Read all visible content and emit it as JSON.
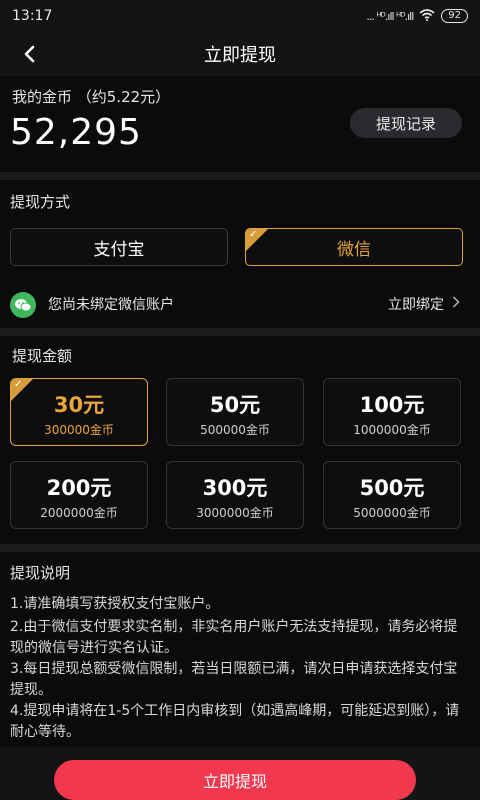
{
  "status": {
    "time": "13:17",
    "network": "... ᴴᴰ.ıll ᴴᴰ.ıll",
    "battery": "92"
  },
  "nav": {
    "title": "立即提现"
  },
  "coins": {
    "label": "我的金币 （约5.22元）",
    "value": "52,295",
    "record_button": "提现记录"
  },
  "method": {
    "title": "提现方式",
    "options": [
      {
        "label": "支付宝",
        "selected": false
      },
      {
        "label": "微信",
        "selected": true
      }
    ],
    "bind_notice": "您尚未绑定微信账户",
    "bind_link": "立即绑定",
    "bind_chevron": ">"
  },
  "amount": {
    "title": "提现金额",
    "options": [
      {
        "amount": "30元",
        "coins": "300000金币",
        "selected": true
      },
      {
        "amount": "50元",
        "coins": "500000金币",
        "selected": false
      },
      {
        "amount": "100元",
        "coins": "1000000金币",
        "selected": false
      },
      {
        "amount": "200元",
        "coins": "2000000金币",
        "selected": false
      },
      {
        "amount": "300元",
        "coins": "3000000金币",
        "selected": false
      },
      {
        "amount": "500元",
        "coins": "5000000金币",
        "selected": false
      }
    ]
  },
  "notes": {
    "title": "提现说明",
    "items": [
      "1.请准确填写获授权支付宝账户。",
      "2.由于微信支付要求实名制，非实名用户账户无法支持提现，请务必将提现的微信号进行实名认证。",
      "3.每日提现总额受微信限制，若当日限额已满，请次日申请获选择支付宝提现。",
      "4.提现申请将在1-5个工作日内审核到（如遇高峰期，可能延迟到账），请耐心等待。"
    ]
  },
  "submit": {
    "label": "立即提现"
  },
  "colors": {
    "accent_gold": "#e8a63c",
    "primary_red": "#f1384f",
    "wechat_green": "#3fb85b"
  },
  "icons": {
    "back": "chevron-left-icon",
    "wechat": "wechat-icon",
    "selected": "check-corner-icon"
  }
}
